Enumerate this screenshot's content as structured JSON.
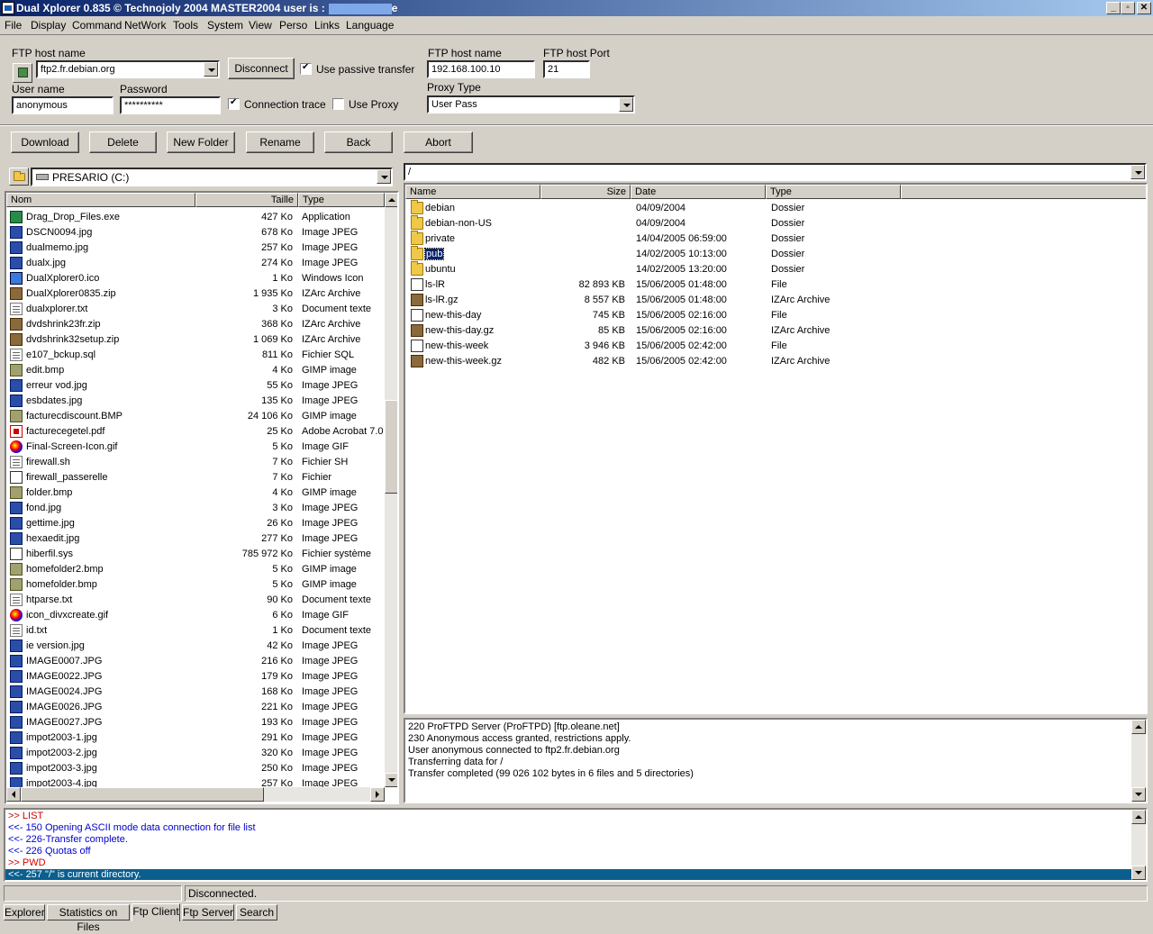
{
  "window": {
    "title": "Dual Xplorer 0.835  © Technojoly 2004   MASTER2004    user is :",
    "title_suffix": "e",
    "minimize_glyph": "_",
    "maximize_glyph": "▫",
    "close_glyph": "✕"
  },
  "menu": [
    "File",
    "Display",
    "Command",
    "NetWork",
    "Tools",
    "System",
    "View",
    "Perso",
    "Links",
    "Language"
  ],
  "ftp": {
    "host_label": "FTP host name",
    "host_value": "ftp2.fr.debian.org",
    "disconnect_label": "Disconnect",
    "passive_label": "Use passive transfer",
    "passive_checked": true,
    "user_label": "User name",
    "user_value": "anonymous",
    "password_label": "Password",
    "password_value": "**********",
    "trace_label": "Connection trace",
    "trace_checked": true,
    "proxy_label": "Use Proxy",
    "proxy_checked": false,
    "proxy_host_label": "FTP host name",
    "proxy_host_value": "192.168.100.10",
    "proxy_port_label": "FTP host Port",
    "proxy_port_value": "21",
    "proxy_type_label": "Proxy Type",
    "proxy_type_value": "User Pass"
  },
  "toolbar": {
    "download": "Download",
    "delete": "Delete",
    "new_folder": "New Folder",
    "rename": "Rename",
    "back": "Back",
    "abort": "Abort"
  },
  "local": {
    "drive": "PRESARIO (C:)",
    "columns": {
      "name": "Nom",
      "size": "Taille",
      "type": "Type"
    },
    "files": [
      {
        "name": "Drag_Drop_Files.exe",
        "size": "427 Ko",
        "type": "Application",
        "icon": "exe"
      },
      {
        "name": "DSCN0094.jpg",
        "size": "678 Ko",
        "type": "Image JPEG",
        "icon": "img"
      },
      {
        "name": "dualmemo.jpg",
        "size": "257 Ko",
        "type": "Image JPEG",
        "icon": "img"
      },
      {
        "name": "dualx.jpg",
        "size": "274 Ko",
        "type": "Image JPEG",
        "icon": "img"
      },
      {
        "name": "DualXplorer0.ico",
        "size": "1 Ko",
        "type": "Windows Icon",
        "icon": "ico"
      },
      {
        "name": "DualXplorer0835.zip",
        "size": "1 935 Ko",
        "type": "IZArc Archive",
        "icon": "zip"
      },
      {
        "name": "dualxplorer.txt",
        "size": "3 Ko",
        "type": "Document texte",
        "icon": "doc"
      },
      {
        "name": "dvdshrink23fr.zip",
        "size": "368 Ko",
        "type": "IZArc Archive",
        "icon": "zip"
      },
      {
        "name": "dvdshrink32setup.zip",
        "size": "1 069 Ko",
        "type": "IZArc Archive",
        "icon": "zip"
      },
      {
        "name": "e107_bckup.sql",
        "size": "811 Ko",
        "type": "Fichier SQL",
        "icon": "doc"
      },
      {
        "name": "edit.bmp",
        "size": "4 Ko",
        "type": "GIMP image",
        "icon": "bmp"
      },
      {
        "name": "erreur vod.jpg",
        "size": "55 Ko",
        "type": "Image JPEG",
        "icon": "img"
      },
      {
        "name": "esbdates.jpg",
        "size": "135 Ko",
        "type": "Image JPEG",
        "icon": "img"
      },
      {
        "name": "facturecdiscount.BMP",
        "size": "24 106 Ko",
        "type": "GIMP image",
        "icon": "bmp"
      },
      {
        "name": "facturecegetel.pdf",
        "size": "25 Ko",
        "type": "Adobe Acrobat 7.0",
        "icon": "pdf"
      },
      {
        "name": "Final-Screen-Icon.gif",
        "size": "5 Ko",
        "type": "Image GIF",
        "icon": "gif"
      },
      {
        "name": "firewall.sh",
        "size": "7 Ko",
        "type": "Fichier SH",
        "icon": "doc"
      },
      {
        "name": "firewall_passerelle",
        "size": "7 Ko",
        "type": "Fichier",
        "icon": "sys"
      },
      {
        "name": "folder.bmp",
        "size": "4 Ko",
        "type": "GIMP image",
        "icon": "bmp"
      },
      {
        "name": "fond.jpg",
        "size": "3 Ko",
        "type": "Image JPEG",
        "icon": "img"
      },
      {
        "name": "gettime.jpg",
        "size": "26 Ko",
        "type": "Image JPEG",
        "icon": "img"
      },
      {
        "name": "hexaedit.jpg",
        "size": "277 Ko",
        "type": "Image JPEG",
        "icon": "img"
      },
      {
        "name": "hiberfil.sys",
        "size": "785 972 Ko",
        "type": "Fichier système",
        "icon": "sys"
      },
      {
        "name": "homefolder2.bmp",
        "size": "5 Ko",
        "type": "GIMP image",
        "icon": "bmp"
      },
      {
        "name": "homefolder.bmp",
        "size": "5 Ko",
        "type": "GIMP image",
        "icon": "bmp"
      },
      {
        "name": "htparse.txt",
        "size": "90 Ko",
        "type": "Document texte",
        "icon": "doc"
      },
      {
        "name": "icon_divxcreate.gif",
        "size": "6 Ko",
        "type": "Image GIF",
        "icon": "gif"
      },
      {
        "name": "id.txt",
        "size": "1 Ko",
        "type": "Document texte",
        "icon": "doc"
      },
      {
        "name": "ie version.jpg",
        "size": "42 Ko",
        "type": "Image JPEG",
        "icon": "img"
      },
      {
        "name": "IMAGE0007.JPG",
        "size": "216 Ko",
        "type": "Image JPEG",
        "icon": "img"
      },
      {
        "name": "IMAGE0022.JPG",
        "size": "179 Ko",
        "type": "Image JPEG",
        "icon": "img"
      },
      {
        "name": "IMAGE0024.JPG",
        "size": "168 Ko",
        "type": "Image JPEG",
        "icon": "img"
      },
      {
        "name": "IMAGE0026.JPG",
        "size": "221 Ko",
        "type": "Image JPEG",
        "icon": "img"
      },
      {
        "name": "IMAGE0027.JPG",
        "size": "193 Ko",
        "type": "Image JPEG",
        "icon": "img"
      },
      {
        "name": "impot2003-1.jpg",
        "size": "291 Ko",
        "type": "Image JPEG",
        "icon": "img"
      },
      {
        "name": "impot2003-2.jpg",
        "size": "320 Ko",
        "type": "Image JPEG",
        "icon": "img"
      },
      {
        "name": "impot2003-3.jpg",
        "size": "250 Ko",
        "type": "Image JPEG",
        "icon": "img"
      },
      {
        "name": "impot2003-4.jpg",
        "size": "257 Ko",
        "type": "Image JPEG",
        "icon": "img"
      }
    ]
  },
  "remote": {
    "path": "/",
    "columns": {
      "name": "Name",
      "size": "Size",
      "date": "Date",
      "type": "Type"
    },
    "files": [
      {
        "name": "debian",
        "size": "",
        "date": "04/09/2004",
        "type": "Dossier",
        "icon": "folder"
      },
      {
        "name": "debian-non-US",
        "size": "",
        "date": "04/09/2004",
        "type": "Dossier",
        "icon": "folder"
      },
      {
        "name": "private",
        "size": "",
        "date": "14/04/2005 06:59:00",
        "type": "Dossier",
        "icon": "folder"
      },
      {
        "name": "pub",
        "size": "",
        "date": "14/02/2005 10:13:00",
        "type": "Dossier",
        "icon": "folder",
        "selected": true
      },
      {
        "name": "ubuntu",
        "size": "",
        "date": "14/02/2005 13:20:00",
        "type": "Dossier",
        "icon": "folder"
      },
      {
        "name": "ls-lR",
        "size": "82 893 KB",
        "date": "15/06/2005 01:48:00",
        "type": "File",
        "icon": "sys"
      },
      {
        "name": "ls-lR.gz",
        "size": "8 557 KB",
        "date": "15/06/2005 01:48:00",
        "type": "IZArc Archive",
        "icon": "zip"
      },
      {
        "name": "new-this-day",
        "size": "745 KB",
        "date": "15/06/2005 02:16:00",
        "type": "File",
        "icon": "sys"
      },
      {
        "name": "new-this-day.gz",
        "size": "85 KB",
        "date": "15/06/2005 02:16:00",
        "type": "IZArc Archive",
        "icon": "zip"
      },
      {
        "name": "new-this-week",
        "size": "3 946 KB",
        "date": "15/06/2005 02:42:00",
        "type": "File",
        "icon": "sys"
      },
      {
        "name": "new-this-week.gz",
        "size": "482 KB",
        "date": "15/06/2005 02:42:00",
        "type": "IZArc Archive",
        "icon": "zip"
      }
    ]
  },
  "server_log": [
    "220 ProFTPD Server (ProFTPD) [ftp.oleane.net]",
    "230 Anonymous access granted, restrictions apply.",
    "User anonymous connected to ftp2.fr.debian.org",
    "Transferring data for /",
    "Transfer completed (99 026 102 bytes in 6 files and 5 directories)"
  ],
  "trace_log": [
    {
      "text": ">> LIST",
      "kind": "cmd"
    },
    {
      "text": "<<- 150 Opening ASCII mode data connection for file list",
      "kind": "resp"
    },
    {
      "text": "<<- 226-Transfer complete.",
      "kind": "resp"
    },
    {
      "text": "<<- 226 Quotas off",
      "kind": "resp"
    },
    {
      "text": ">> PWD",
      "kind": "cmd"
    },
    {
      "text": "<<- 257 \"/\" is current directory.",
      "kind": "selected"
    }
  ],
  "colors": {
    "cmd": "#d00000",
    "resp": "#0000cc",
    "selected_bg": "#0a5f8f"
  },
  "status": {
    "left": "",
    "right": "Disconnected."
  },
  "tabs": [
    "Explorer",
    "Statistics on Files",
    "Ftp Client",
    "Ftp Server",
    "Search"
  ],
  "active_tab": "Ftp Client"
}
